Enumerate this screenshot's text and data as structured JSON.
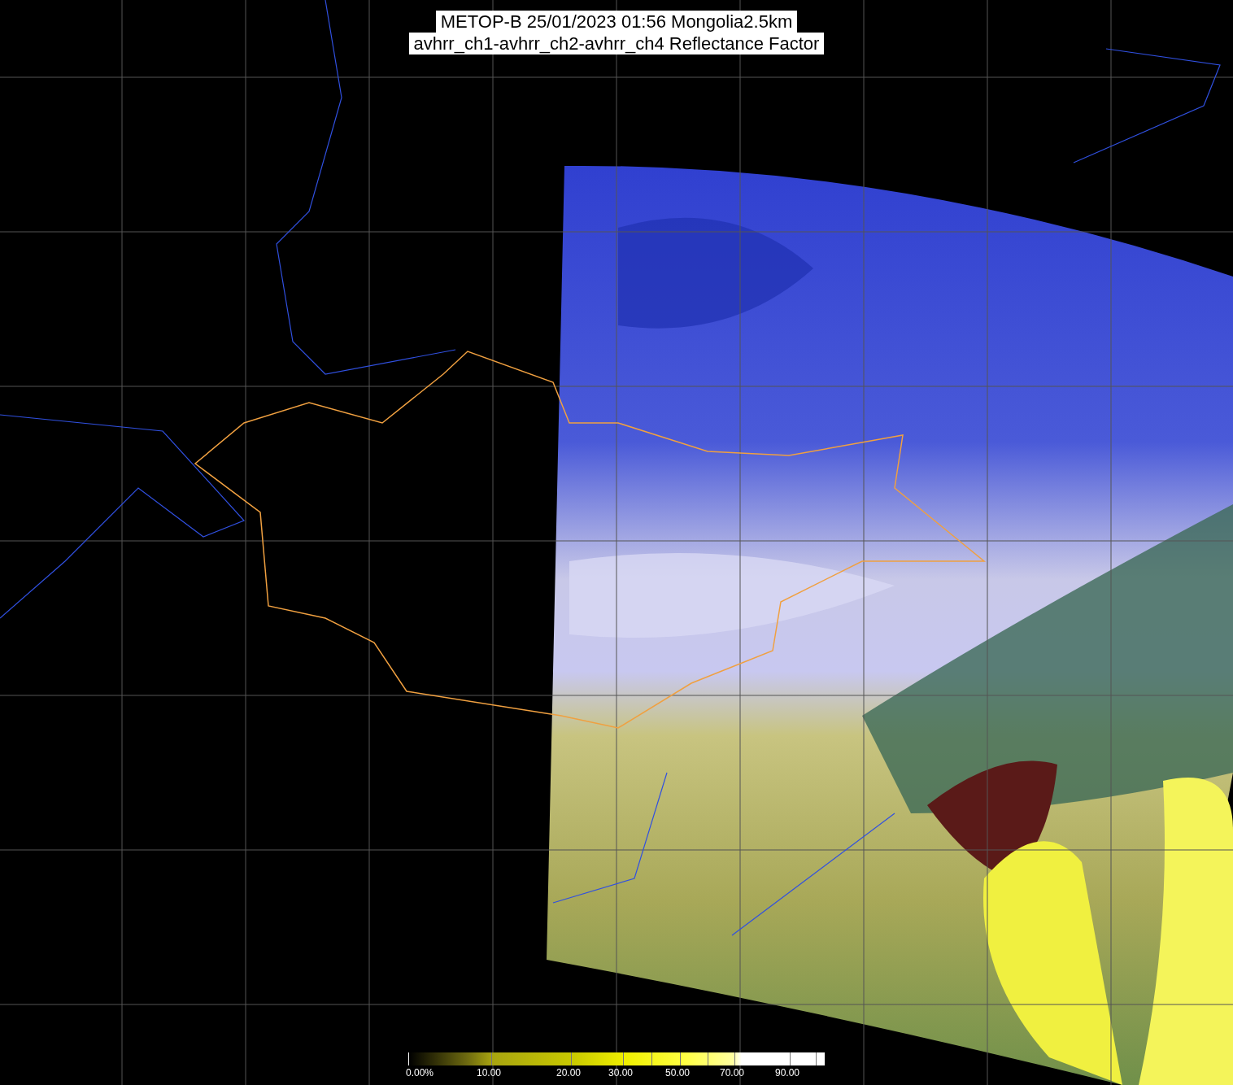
{
  "title": {
    "lines": [
      "METOP-B 25/01/2023 01:56 Mongolia2.5km",
      "avhrr_ch1-avhrr_ch2-avhrr_ch4 Reflectance Factor"
    ]
  },
  "legend": {
    "labels": [
      "0.00%",
      "10.00",
      "20.00",
      "30.00",
      "50.00",
      "70.00",
      "90.00"
    ]
  }
}
